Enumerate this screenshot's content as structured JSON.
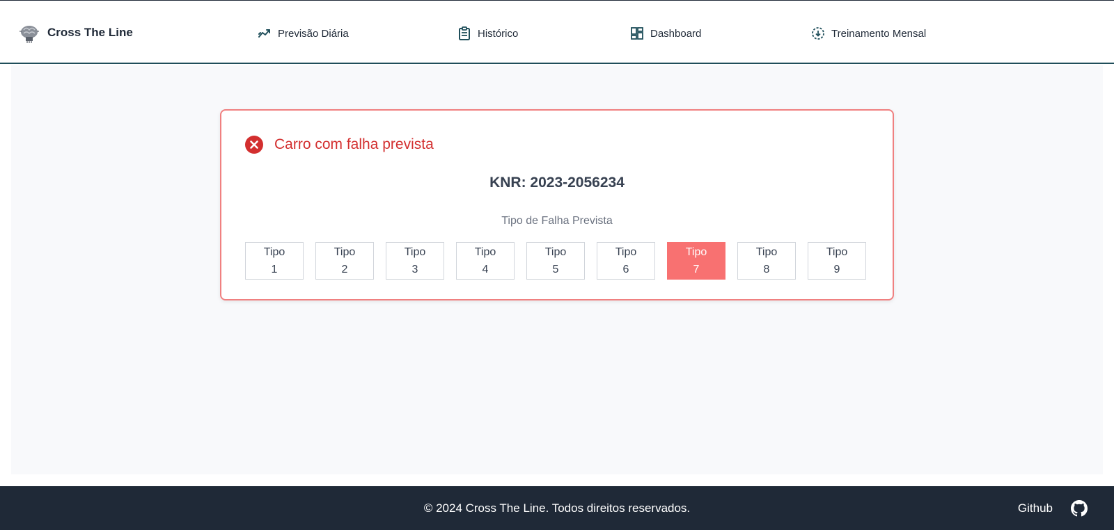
{
  "header": {
    "brand_name": "Cross The Line",
    "nav": [
      {
        "label": "Previsão Diária",
        "icon": "trend-chart-icon"
      },
      {
        "label": "Histórico",
        "icon": "clipboard-icon"
      },
      {
        "label": "Dashboard",
        "icon": "dashboard-icon"
      },
      {
        "label": "Treinamento Mensal",
        "icon": "download-circle-icon"
      }
    ]
  },
  "result": {
    "title": "Carro com falha prevista",
    "knr": "KNR: 2023-2056234",
    "types_label": "Tipo de Falha Prevista",
    "types": [
      {
        "word": "Tipo",
        "num": "1"
      },
      {
        "word": "Tipo",
        "num": "2"
      },
      {
        "word": "Tipo",
        "num": "3"
      },
      {
        "word": "Tipo",
        "num": "4"
      },
      {
        "word": "Tipo",
        "num": "5"
      },
      {
        "word": "Tipo",
        "num": "6"
      },
      {
        "word": "Tipo",
        "num": "7"
      },
      {
        "word": "Tipo",
        "num": "8"
      },
      {
        "word": "Tipo",
        "num": "9"
      }
    ],
    "selected_type": "7"
  },
  "footer": {
    "copyright": "© 2024 Cross The Line. Todos direitos reservados.",
    "github_label": "Github"
  },
  "colors": {
    "accent": "#1f4e5a",
    "error": "#d32f2f",
    "highlight": "#f87171",
    "footer_bg": "#1f2937"
  }
}
